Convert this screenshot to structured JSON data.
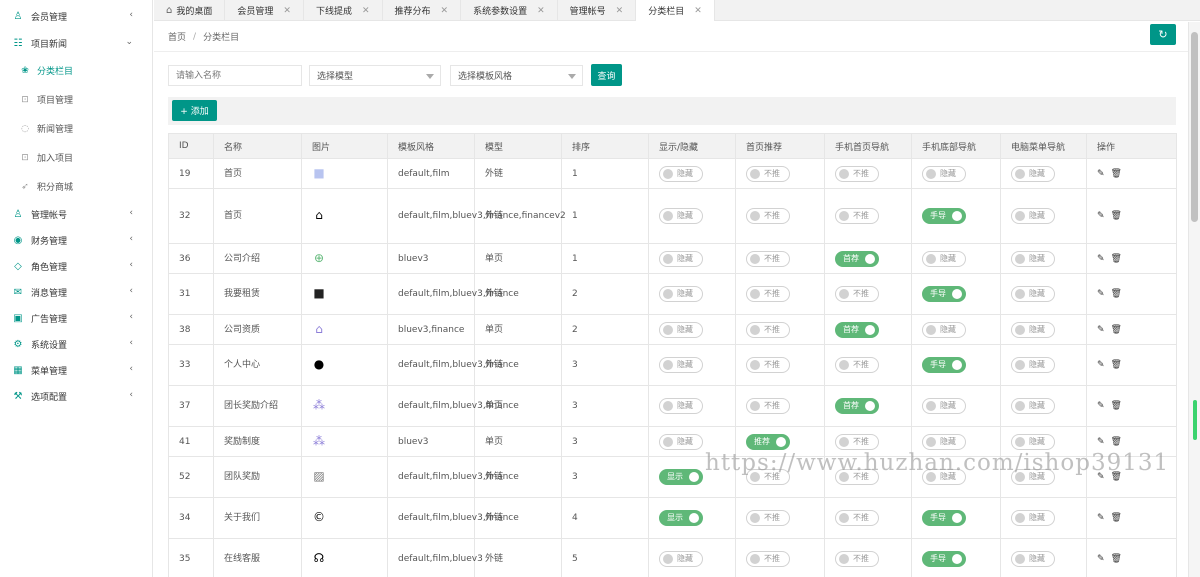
{
  "sidebar": {
    "items": [
      {
        "label": "会员管理",
        "icon": "user-icon",
        "glyph": "♙",
        "chev": "‹"
      },
      {
        "label": "项目新闻",
        "icon": "group-icon",
        "glyph": "☷",
        "chev": "⌄"
      },
      {
        "label": "管理帐号",
        "icon": "user-icon",
        "glyph": "♙",
        "chev": "‹"
      },
      {
        "label": "财务管理",
        "icon": "finance-icon",
        "glyph": "◉",
        "chev": "‹"
      },
      {
        "label": "角色管理",
        "icon": "shield-icon",
        "glyph": "◇",
        "chev": "‹"
      },
      {
        "label": "消息管理",
        "icon": "message-icon",
        "glyph": "✉",
        "chev": "‹"
      },
      {
        "label": "广告管理",
        "icon": "image-icon",
        "glyph": "▣",
        "chev": "‹"
      },
      {
        "label": "系统设置",
        "icon": "gear-icon",
        "glyph": "⚙",
        "chev": "‹"
      },
      {
        "label": "菜单管理",
        "icon": "menu-icon",
        "glyph": "▦",
        "chev": "‹"
      },
      {
        "label": "选项配置",
        "icon": "settings-icon",
        "glyph": "⚒",
        "chev": "‹"
      }
    ],
    "subitems": [
      {
        "label": "分类栏目",
        "icon": "leaf-icon",
        "glyph": "❀"
      },
      {
        "label": "项目管理",
        "icon": "cart-icon",
        "glyph": "⊡"
      },
      {
        "label": "新闻管理",
        "icon": "circle-icon",
        "glyph": "◌"
      },
      {
        "label": "加入项目",
        "icon": "cart-icon",
        "glyph": "⊡"
      },
      {
        "label": "积分商城",
        "icon": "send-icon",
        "glyph": "➶"
      }
    ]
  },
  "tabs": [
    {
      "label": "我的桌面",
      "home": "⌂"
    },
    {
      "label": "会员管理",
      "close": "✕"
    },
    {
      "label": "下线提成",
      "close": "✕"
    },
    {
      "label": "推荐分布",
      "close": "✕"
    },
    {
      "label": "系统参数设置",
      "close": "✕"
    },
    {
      "label": "管理帐号",
      "close": "✕"
    },
    {
      "label": "分类栏目",
      "close": "✕"
    }
  ],
  "breadcrumb": {
    "home": "首页",
    "sep": "/",
    "current": "分类栏目"
  },
  "refresh_glyph": "↻",
  "search": {
    "placeholder": "请输入名称",
    "model_select": "选择模型",
    "style_select": "选择模板风格",
    "query_button": "查询"
  },
  "add_button": "+ 添加",
  "table": {
    "headers": [
      "ID",
      "名称",
      "图片",
      "模板风格",
      "模型",
      "排序",
      "显示/隐藏",
      "首页推荐",
      "手机首页导航",
      "手机底部导航",
      "电脑菜单导航",
      "操作"
    ],
    "rows": [
      {
        "id": "19",
        "name": "首页",
        "pic": "■",
        "pic_color": "#b8c4f0",
        "style": "default,film",
        "model": "外链",
        "sort": "1",
        "show": "隐藏",
        "rec": "不推",
        "mnav": "不推",
        "mbot": "隐藏",
        "pcnav": "隐藏"
      },
      {
        "id": "32",
        "name": "首页",
        "pic": "⌂",
        "pic_color": "#000000",
        "style": "default,film,bluev3,finance,financev2",
        "model": "外链",
        "sort": "1",
        "show": "隐藏",
        "rec": "不推",
        "mnav": "不推",
        "mbot": "手导",
        "pcnav": "隐藏"
      },
      {
        "id": "36",
        "name": "公司介绍",
        "pic": "⊕",
        "pic_color": "#5fb878",
        "style": "bluev3",
        "model": "单页",
        "sort": "1",
        "show": "隐藏",
        "rec": "不推",
        "mnav": "首荐",
        "mbot": "隐藏",
        "pcnav": "隐藏"
      },
      {
        "id": "31",
        "name": "我要租赁",
        "pic": "■",
        "pic_color": "#222222",
        "style": "default,film,bluev3,finance",
        "model": "外链",
        "sort": "2",
        "show": "隐藏",
        "rec": "不推",
        "mnav": "不推",
        "mbot": "手导",
        "pcnav": "隐藏"
      },
      {
        "id": "38",
        "name": "公司资质",
        "pic": "⌂",
        "pic_color": "#8d7fd8",
        "style": "bluev3,finance",
        "model": "单页",
        "sort": "2",
        "show": "隐藏",
        "rec": "不推",
        "mnav": "首荐",
        "mbot": "隐藏",
        "pcnav": "隐藏"
      },
      {
        "id": "33",
        "name": "个人中心",
        "pic": "●",
        "pic_color": "#000000",
        "style": "default,film,bluev3,finance",
        "model": "外链",
        "sort": "3",
        "show": "隐藏",
        "rec": "不推",
        "mnav": "不推",
        "mbot": "手导",
        "pcnav": "隐藏"
      },
      {
        "id": "37",
        "name": "团长奖励介绍",
        "pic": "⁂",
        "pic_color": "#8d7fd8",
        "style": "default,film,bluev3,finance",
        "model": "单页",
        "sort": "3",
        "show": "隐藏",
        "rec": "不推",
        "mnav": "首荐",
        "mbot": "隐藏",
        "pcnav": "隐藏"
      },
      {
        "id": "41",
        "name": "奖励制度",
        "pic": "⁂",
        "pic_color": "#8d7fd8",
        "style": "bluev3",
        "model": "单页",
        "sort": "3",
        "show": "隐藏",
        "rec": "推荐",
        "mnav": "不推",
        "mbot": "隐藏",
        "pcnav": "隐藏"
      },
      {
        "id": "52",
        "name": "团队奖励",
        "pic": "▨",
        "pic_color": "#777777",
        "style": "default,film,bluev3,finance",
        "model": "外链",
        "sort": "3",
        "show": "显示",
        "rec": "不推",
        "mnav": "不推",
        "mbot": "隐藏",
        "pcnav": "隐藏"
      },
      {
        "id": "34",
        "name": "关于我们",
        "pic": "©",
        "pic_color": "#000000",
        "style": "default,film,bluev3,finance",
        "model": "外链",
        "sort": "4",
        "show": "显示",
        "rec": "不推",
        "mnav": "不推",
        "mbot": "手导",
        "pcnav": "隐藏"
      },
      {
        "id": "35",
        "name": "在线客服",
        "pic": "☊",
        "pic_color": "#000000",
        "style": "default,film,bluev3",
        "model": "外链",
        "sort": "5",
        "show": "隐藏",
        "rec": "不推",
        "mnav": "不推",
        "mbot": "手导",
        "pcnav": "隐藏"
      }
    ],
    "ops": {
      "edit": "✎",
      "delete": "🗑"
    }
  },
  "watermark": "https://www.huzhan.com/ishop39131",
  "colors": {
    "accent": "#009688",
    "switch_on": "#5fb878"
  }
}
